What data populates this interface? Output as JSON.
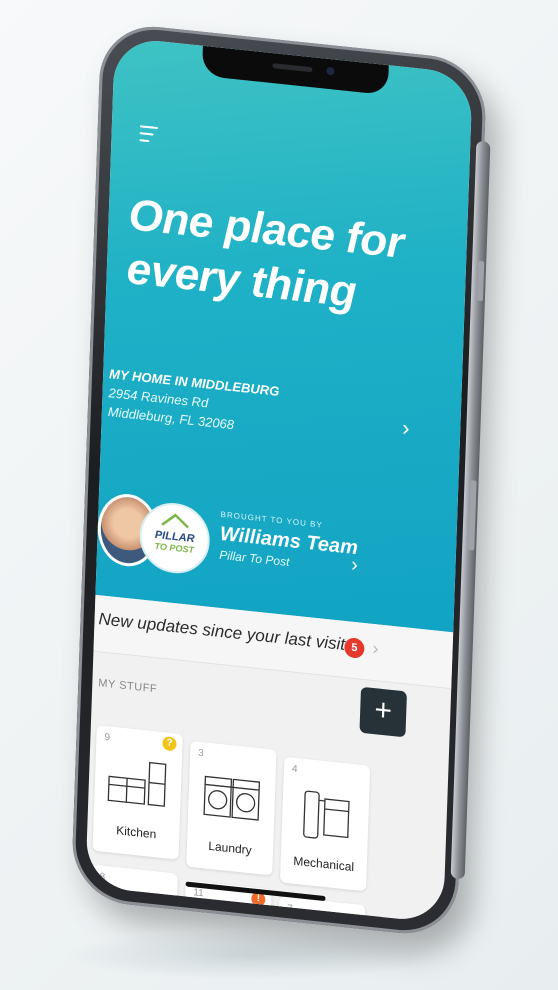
{
  "headline": "One place for every thing",
  "home": {
    "title": "MY HOME IN MIDDLEBURG",
    "address_line1": "2954 Ravines Rd",
    "address_line2": "Middleburg, FL 32068"
  },
  "agent": {
    "brought_by": "BROUGHT TO YOU BY",
    "name": "Williams Team",
    "company": "Pillar To Post",
    "logo_top": "PILLAR",
    "logo_bottom": "TO POST"
  },
  "updates": {
    "text": "New updates since your last visit",
    "count": "5"
  },
  "my_stuff": {
    "label": "MY STUFF",
    "add_label": "+",
    "tiles": [
      {
        "count": "9",
        "label": "Kitchen",
        "alert": "?",
        "alert_color": "#f2c318"
      },
      {
        "count": "3",
        "label": "Laundry",
        "alert": "",
        "alert_color": ""
      },
      {
        "count": "4",
        "label": "Mechanical",
        "alert": "",
        "alert_color": ""
      },
      {
        "count": "8",
        "label": "",
        "alert": "",
        "alert_color": ""
      },
      {
        "count": "11",
        "label": "",
        "alert": "!",
        "alert_color": "#ee6c2a"
      },
      {
        "count": "7",
        "label": "",
        "alert": "",
        "alert_color": ""
      }
    ]
  },
  "colors": {
    "hero_teal": "#1fb1c6",
    "badge_red": "#e5392e",
    "add_button_dark": "#263238"
  }
}
